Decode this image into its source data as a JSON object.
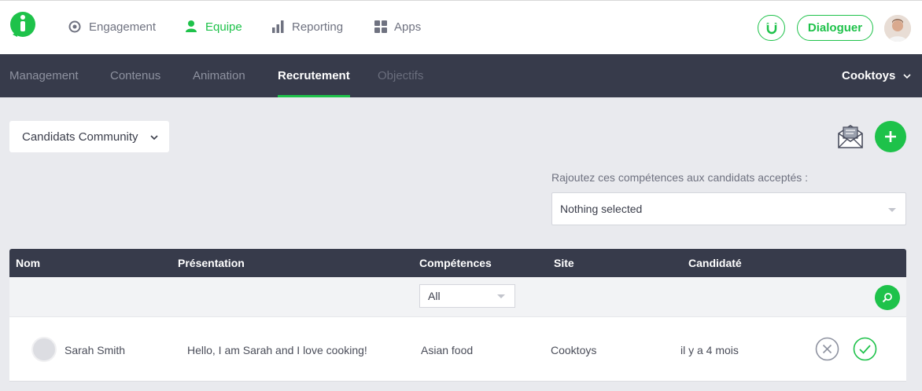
{
  "topnav": {
    "items": [
      {
        "label": "Engagement",
        "icon": "target-icon",
        "active": false
      },
      {
        "label": "Equipe",
        "icon": "person-icon",
        "active": true
      },
      {
        "label": "Reporting",
        "icon": "bar-chart-icon",
        "active": false
      },
      {
        "label": "Apps",
        "icon": "grid-icon",
        "active": false
      }
    ],
    "dialog_label": "Dialoguer"
  },
  "subnav": {
    "items": [
      {
        "label": "Management"
      },
      {
        "label": "Contenus"
      },
      {
        "label": "Animation"
      },
      {
        "label": "Recrutement"
      },
      {
        "label": "Objectifs"
      }
    ],
    "company": "Cooktoys"
  },
  "filters": {
    "candidates_dropdown": "Candidats Community",
    "skills_label": "Rajoutez ces compétences aux candidats acceptés :",
    "skills_value": "Nothing selected"
  },
  "table": {
    "columns": [
      "Nom",
      "Présentation",
      "Compétences",
      "Site",
      "Candidaté"
    ],
    "competences_filter": "All",
    "rows": [
      {
        "name": "Sarah Smith",
        "presentation": "Hello, I am Sarah and I love cooking!",
        "competences": "Asian food",
        "site": "Cooktoys",
        "candidate": "il y a 4 mois"
      }
    ]
  },
  "colors": {
    "accent": "#1ec24a",
    "dark": "#373b4b"
  }
}
